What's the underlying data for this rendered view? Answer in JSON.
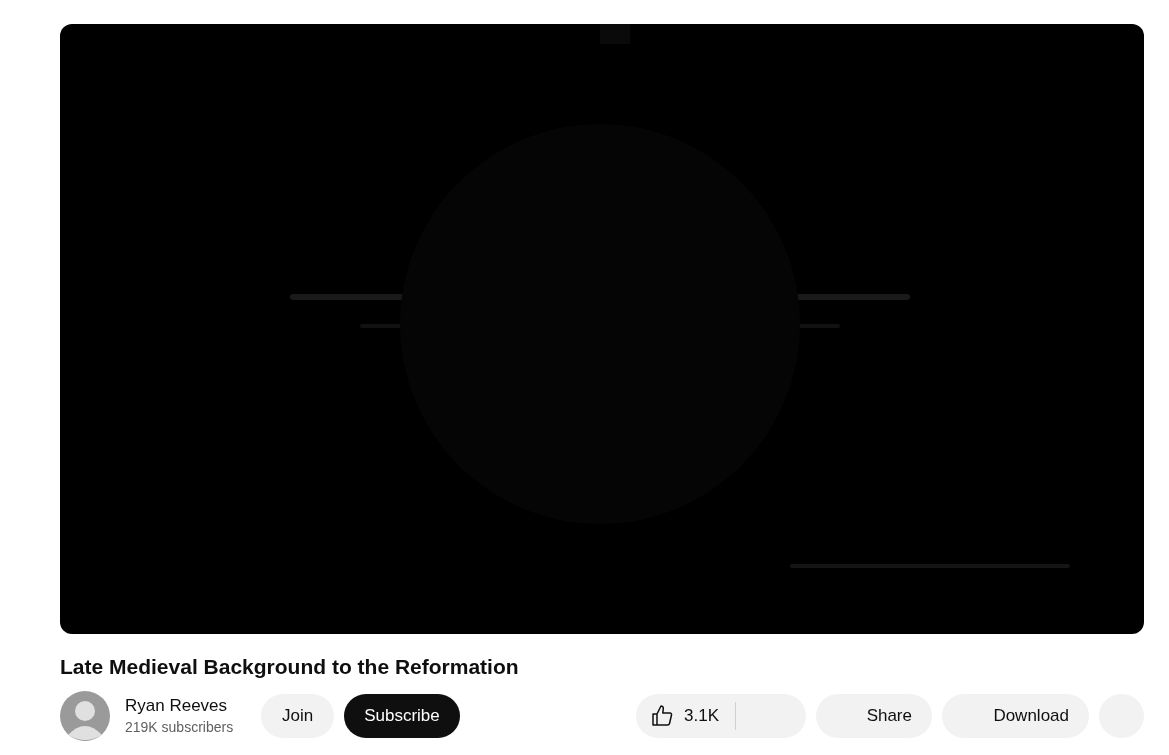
{
  "title": "Late Medieval Background to the Reformation",
  "channel": {
    "name": "Ryan Reeves",
    "subscribers": "219K subscribers"
  },
  "join_button": "Join",
  "subscribe_button": "Subscribe",
  "likes": "3.1K",
  "share_button": "Share",
  "download_button": "Download"
}
